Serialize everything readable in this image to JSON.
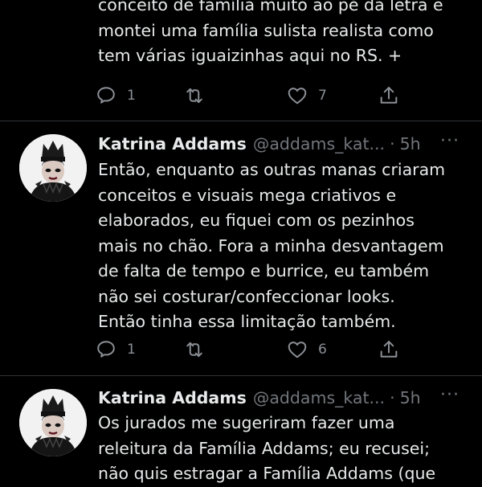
{
  "colors": {
    "background": "#000000",
    "text": "#e7e9ea",
    "muted": "#71767b",
    "divider": "#2f3336"
  },
  "tweets": [
    {
      "lines": [
        "conceito de família muito ao pé da letra e",
        "montei uma família sulista realista como",
        "tem várias iguaizinhas aqui no RS. +"
      ],
      "actions": {
        "reply_count": "1",
        "retweet_count": "",
        "like_count": "7"
      },
      "icons": [
        "reply-icon",
        "retweet-icon",
        "like-icon",
        "share-icon"
      ]
    },
    {
      "author": {
        "name": "Katrina Addams",
        "handle": "@addams_kat...",
        "separator": "·",
        "time": "5h",
        "more": "···"
      },
      "lines": [
        "Então, enquanto as outras manas criaram",
        "conceitos e visuais mega criativos e",
        "elaborados, eu fiquei com os pezinhos",
        "mais no chão. Fora a minha desvantagem",
        "de falta de tempo e burrice, eu também",
        "não sei costurar/confeccionar looks.",
        "Então tinha essa limitação também."
      ],
      "actions": {
        "reply_count": "1",
        "retweet_count": "",
        "like_count": "6"
      },
      "icons": [
        "reply-icon",
        "retweet-icon",
        "like-icon",
        "share-icon"
      ]
    },
    {
      "author": {
        "name": "Katrina Addams",
        "handle": "@addams_kat...",
        "separator": "·",
        "time": "5h",
        "more": "···"
      },
      "lines": [
        "Os jurados me sugeriram fazer uma",
        "releitura da Família Addams; eu recusei;",
        "não quis estragar a Família Addams (que"
      ]
    }
  ]
}
